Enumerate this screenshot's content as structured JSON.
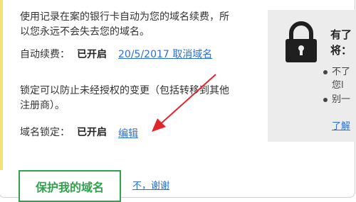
{
  "content": {
    "intro_line1": "使用记录在案的银行卡自动为您的域名续费，所",
    "intro_line2": "以您永远不会失去您的域名。",
    "autorenew_label": "自动续费：",
    "autorenew_status": "已开启",
    "autorenew_link": "20/5/2017 取消域名",
    "lock_desc_line1": "锁定可以防止未经授权的变更（包括转移到其他",
    "lock_desc_line2": "注册商）。",
    "domain_lock_label": "域名锁定：",
    "domain_lock_status": "已开启",
    "domain_lock_edit": "编辑"
  },
  "side_panel": {
    "title_line1": "有了",
    "title_line2": "将：",
    "item1_line1": "不了",
    "item1_line2": "您l",
    "item2": "别一",
    "link": "了解"
  },
  "actions": {
    "protect_button": "保护我的域名",
    "decline_link": "不，谢谢"
  },
  "colors": {
    "accent_green": "#2fa24c",
    "link_blue": "#2a6fd6",
    "arrow_red": "#e0262b",
    "panel_gray": "#ececec",
    "accent_yellow": "#f5df77"
  },
  "icons": {
    "side_panel": "lock-icon",
    "annotation": "red-arrow"
  }
}
